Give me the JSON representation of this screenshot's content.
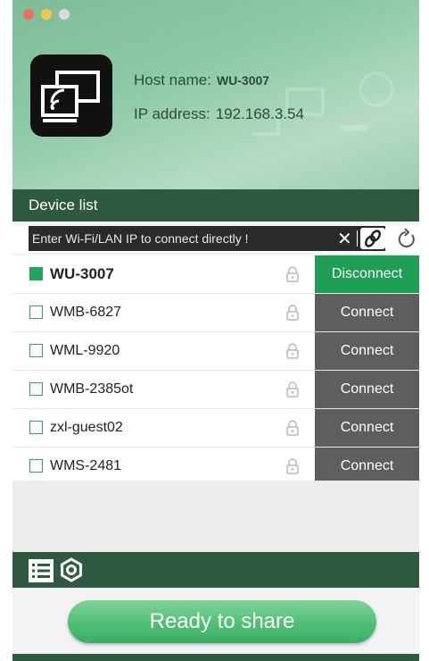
{
  "host": {
    "name_label": "Host name:",
    "name_value": "WU-3007",
    "ip_label": "IP address:",
    "ip_value": "192.168.3.54"
  },
  "device_list": {
    "title": "Device list",
    "ip_placeholder": "Enter Wi-Fi/LAN IP to connect directly !",
    "devices": [
      {
        "name": "WU-3007",
        "checked": true,
        "action": "Disconnect"
      },
      {
        "name": "WMB-6827",
        "checked": false,
        "action": "Connect"
      },
      {
        "name": "WML-9920",
        "checked": false,
        "action": "Connect"
      },
      {
        "name": "WMB-2385ot",
        "checked": false,
        "action": "Connect"
      },
      {
        "name": "zxl-guest02",
        "checked": false,
        "action": "Connect"
      },
      {
        "name": "WMS-2481",
        "checked": false,
        "action": "Connect"
      }
    ]
  },
  "footer": {
    "share_label": "Ready to share"
  },
  "colors": {
    "accent_green": "#1f9e56",
    "dark_green": "#2f5a41",
    "connect_gray": "#5e5e5e"
  },
  "icons": [
    "screen-mirror-icon",
    "clear-icon",
    "link-icon",
    "refresh-icon",
    "lock-icon",
    "list-icon",
    "gear-icon"
  ]
}
